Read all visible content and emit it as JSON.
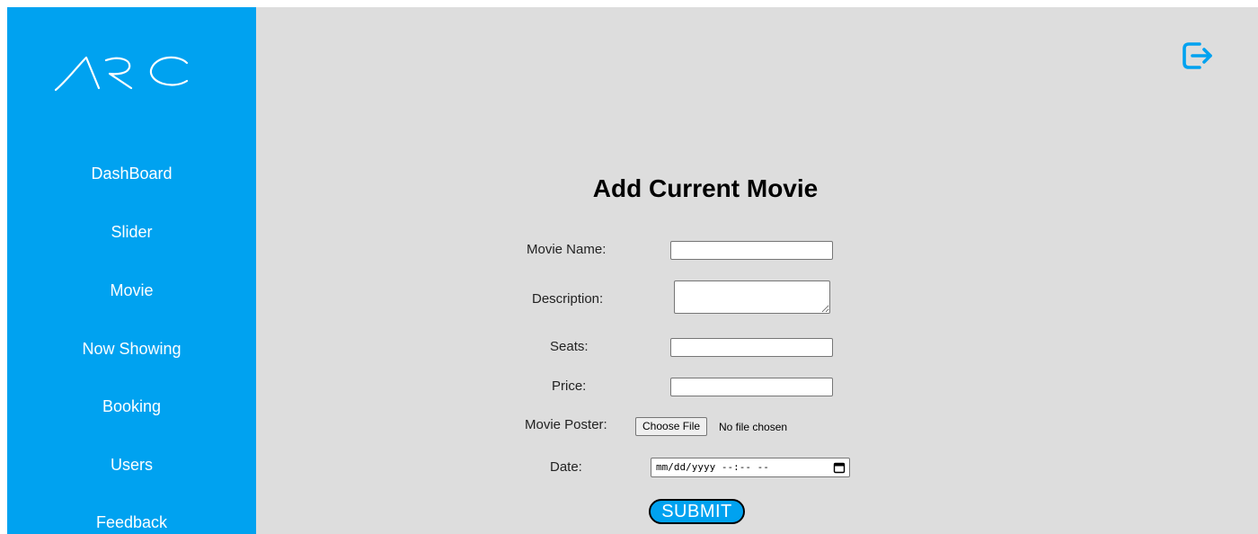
{
  "brand": {
    "logo_text": "ARC",
    "sidebar_color": "#00a2f0",
    "content_bg": "#dddddd"
  },
  "sidebar": {
    "items": [
      {
        "label": "DashBoard"
      },
      {
        "label": "Slider"
      },
      {
        "label": "Movie"
      },
      {
        "label": "Now Showing"
      },
      {
        "label": "Booking"
      },
      {
        "label": "Users"
      },
      {
        "label": "Feedback"
      }
    ]
  },
  "header": {
    "logout_icon": "logout-icon"
  },
  "form": {
    "title": "Add Current Movie",
    "movie_name_label": "Movie Name:",
    "movie_name_value": "",
    "description_label": "Description:",
    "description_value": "",
    "seats_label": "Seats:",
    "seats_value": "",
    "price_label": "Price:",
    "price_value": "",
    "poster_label": "Movie Poster:",
    "poster_button": "Choose File",
    "poster_status": "No file chosen",
    "date_label": "Date:",
    "date_placeholder": "mm/dd/yyyy --:-- --",
    "submit_label": "SUBMIT"
  }
}
